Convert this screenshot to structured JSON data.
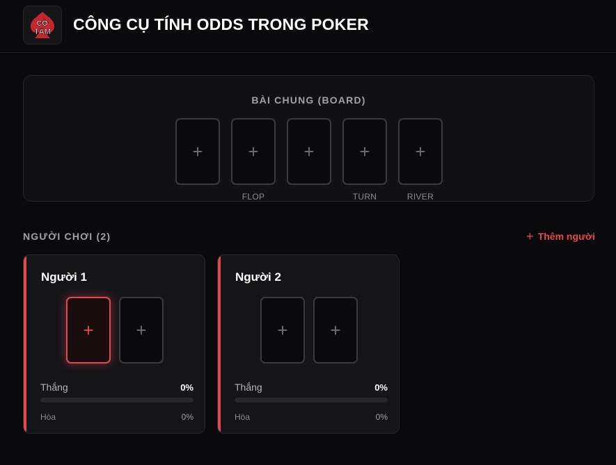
{
  "header": {
    "logo_text_top": "CỜ",
    "logo_text_bottom": "TÂM",
    "title": "CÔNG CỤ TÍNH ODDS TRONG POKER"
  },
  "board": {
    "title": "BÀI CHUNG (BOARD)",
    "slots": [
      {
        "icon": "plus-icon",
        "label": ""
      },
      {
        "icon": "plus-icon",
        "label": "FLOP"
      },
      {
        "icon": "plus-icon",
        "label": ""
      },
      {
        "icon": "plus-icon",
        "label": "TURN"
      },
      {
        "icon": "plus-icon",
        "label": "RIVER"
      }
    ]
  },
  "players_section": {
    "title": "NGƯỜI CHƠI (2)",
    "add_button": "Thêm người",
    "add_icon": "plus-icon"
  },
  "players": [
    {
      "name": "Người 1",
      "win_label": "Thắng",
      "win_value": "0%",
      "win_fraction": 0,
      "draw_label": "Hòa",
      "draw_value": "0%",
      "active_slot": 0
    },
    {
      "name": "Người 2",
      "win_label": "Thắng",
      "win_value": "0%",
      "win_fraction": 0,
      "draw_label": "Hòa",
      "draw_value": "0%",
      "active_slot": null
    }
  ],
  "colors": {
    "accent": "#e5484d",
    "background": "#0a0a0c",
    "panel": "#111114"
  }
}
